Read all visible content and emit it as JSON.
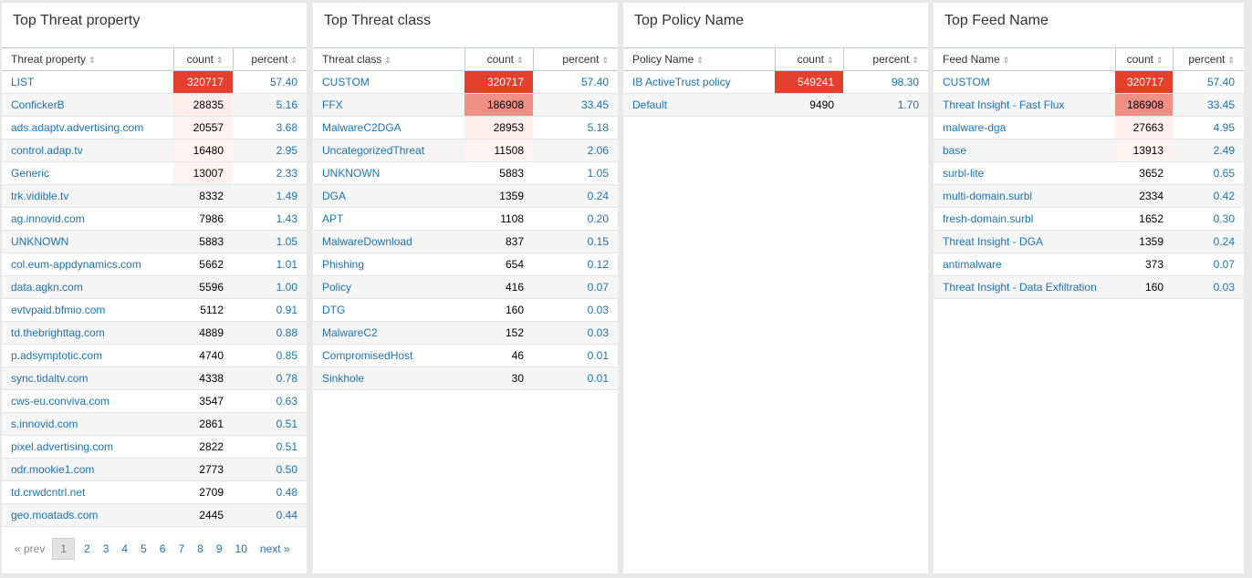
{
  "panels": [
    {
      "title": "Top Threat property",
      "headers": [
        "Threat property",
        "count",
        "percent"
      ],
      "rows": [
        {
          "name": "LIST",
          "count": "320717",
          "percent": "57.40",
          "heat": 1.0
        },
        {
          "name": "ConfickerB",
          "count": "28835",
          "percent": "5.16",
          "heat": 0.09
        },
        {
          "name": "ads.adaptv.advertising.com",
          "count": "20557",
          "percent": "3.68",
          "heat": 0.065
        },
        {
          "name": "control.adap.tv",
          "count": "16480",
          "percent": "2.95",
          "heat": 0.05
        },
        {
          "name": "Generic",
          "count": "13007",
          "percent": "2.33",
          "heat": 0.04
        },
        {
          "name": "trk.vidible.tv",
          "count": "8332",
          "percent": "1.49",
          "heat": 0
        },
        {
          "name": "ag.innovid.com",
          "count": "7986",
          "percent": "1.43",
          "heat": 0
        },
        {
          "name": "UNKNOWN",
          "count": "5883",
          "percent": "1.05",
          "heat": 0
        },
        {
          "name": "col.eum-appdynamics.com",
          "count": "5662",
          "percent": "1.01",
          "heat": 0
        },
        {
          "name": "data.agkn.com",
          "count": "5596",
          "percent": "1.00",
          "heat": 0
        },
        {
          "name": "evtvpaid.bfmio.com",
          "count": "5112",
          "percent": "0.91",
          "heat": 0
        },
        {
          "name": "td.thebrighttag.com",
          "count": "4889",
          "percent": "0.88",
          "heat": 0
        },
        {
          "name": "p.adsymptotic.com",
          "count": "4740",
          "percent": "0.85",
          "heat": 0
        },
        {
          "name": "sync.tidaltv.com",
          "count": "4338",
          "percent": "0.78",
          "heat": 0
        },
        {
          "name": "cws-eu.conviva.com",
          "count": "3547",
          "percent": "0.63",
          "heat": 0
        },
        {
          "name": "s.innovid.com",
          "count": "2861",
          "percent": "0.51",
          "heat": 0
        },
        {
          "name": "pixel.advertising.com",
          "count": "2822",
          "percent": "0.51",
          "heat": 0
        },
        {
          "name": "odr.mookie1.com",
          "count": "2773",
          "percent": "0.50",
          "heat": 0
        },
        {
          "name": "td.crwdcntrl.net",
          "count": "2709",
          "percent": "0.48",
          "heat": 0
        },
        {
          "name": "geo.moatads.com",
          "count": "2445",
          "percent": "0.44",
          "heat": 0
        }
      ],
      "pager": {
        "prev": "« prev",
        "current": "1",
        "pages": [
          "2",
          "3",
          "4",
          "5",
          "6",
          "7",
          "8",
          "9",
          "10"
        ],
        "next": "next »"
      }
    },
    {
      "title": "Top Threat class",
      "headers": [
        "Threat class",
        "count",
        "percent"
      ],
      "rows": [
        {
          "name": "CUSTOM",
          "count": "320717",
          "percent": "57.40",
          "heat": 1.0
        },
        {
          "name": "FFX",
          "count": "186908",
          "percent": "33.45",
          "heat": 0.58
        },
        {
          "name": "MalwareC2DGA",
          "count": "28953",
          "percent": "5.18",
          "heat": 0.09
        },
        {
          "name": "UncategorizedThreat",
          "count": "11508",
          "percent": "2.06",
          "heat": 0.036
        },
        {
          "name": "UNKNOWN",
          "count": "5883",
          "percent": "1.05",
          "heat": 0
        },
        {
          "name": "DGA",
          "count": "1359",
          "percent": "0.24",
          "heat": 0
        },
        {
          "name": "APT",
          "count": "1108",
          "percent": "0.20",
          "heat": 0
        },
        {
          "name": "MalwareDownload",
          "count": "837",
          "percent": "0.15",
          "heat": 0
        },
        {
          "name": "Phishing",
          "count": "654",
          "percent": "0.12",
          "heat": 0
        },
        {
          "name": "Policy",
          "count": "416",
          "percent": "0.07",
          "heat": 0
        },
        {
          "name": "DTG",
          "count": "160",
          "percent": "0.03",
          "heat": 0
        },
        {
          "name": "MalwareC2",
          "count": "152",
          "percent": "0.03",
          "heat": 0
        },
        {
          "name": "CompromisedHost",
          "count": "46",
          "percent": "0.01",
          "heat": 0
        },
        {
          "name": "Sinkhole",
          "count": "30",
          "percent": "0.01",
          "heat": 0
        }
      ]
    },
    {
      "title": "Top Policy Name",
      "headers": [
        "Policy Name",
        "count",
        "percent"
      ],
      "rows": [
        {
          "name": "IB ActiveTrust policy",
          "count": "549241",
          "percent": "98.30",
          "heat": 1.0
        },
        {
          "name": "Default",
          "count": "9490",
          "percent": "1.70",
          "heat": 0
        }
      ]
    },
    {
      "title": "Top Feed Name",
      "headers": [
        "Feed Name",
        "count",
        "percent"
      ],
      "rows": [
        {
          "name": "CUSTOM",
          "count": "320717",
          "percent": "57.40",
          "heat": 1.0
        },
        {
          "name": "Threat Insight - Fast Flux",
          "count": "186908",
          "percent": "33.45",
          "heat": 0.58
        },
        {
          "name": "malware-dga",
          "count": "27663",
          "percent": "4.95",
          "heat": 0.085
        },
        {
          "name": "base",
          "count": "13913",
          "percent": "2.49",
          "heat": 0.043
        },
        {
          "name": "surbl-lite",
          "count": "3652",
          "percent": "0.65",
          "heat": 0
        },
        {
          "name": "multi-domain.surbl",
          "count": "2334",
          "percent": "0.42",
          "heat": 0
        },
        {
          "name": "fresh-domain.surbl",
          "count": "1652",
          "percent": "0.30",
          "heat": 0
        },
        {
          "name": "Threat Insight - DGA",
          "count": "1359",
          "percent": "0.24",
          "heat": 0
        },
        {
          "name": "antimalware",
          "count": "373",
          "percent": "0.07",
          "heat": 0
        },
        {
          "name": "Threat Insight - Data Exfiltration",
          "count": "160",
          "percent": "0.03",
          "heat": 0
        }
      ]
    }
  ],
  "colors": {
    "heat_max": "#e4402d",
    "link": "#1e73b5",
    "sort_icon": "sort-icon"
  }
}
